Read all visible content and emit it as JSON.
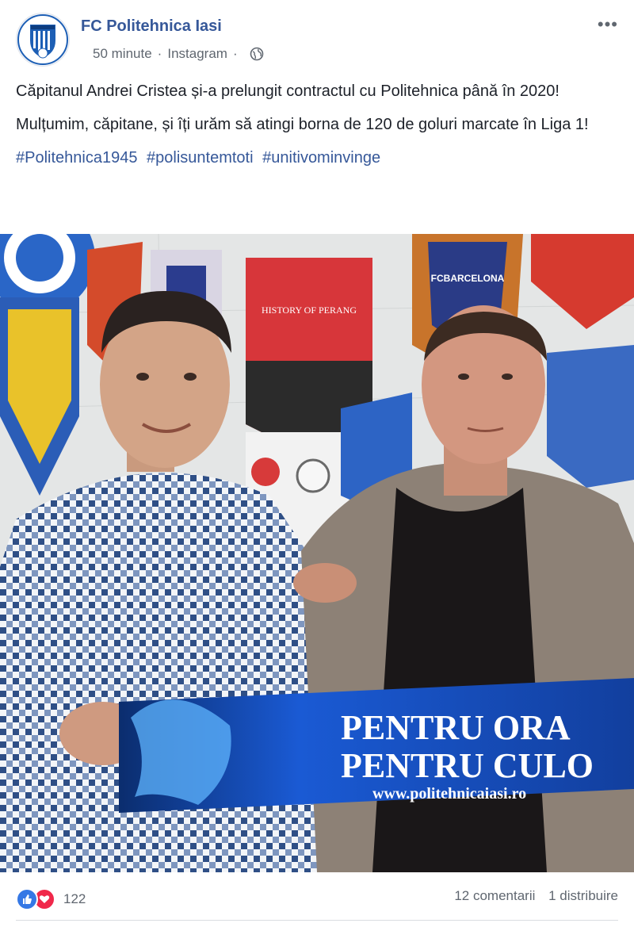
{
  "post": {
    "page_name": "FC Politehnica Iasi",
    "time": "50 minute",
    "separator": "·",
    "source": "Instagram",
    "paragraphs": [
      "Căpitanul Andrei Cristea și-a prelungit contractul cu Politehnica până în 2020!",
      "Mulțumim, căpitane, și îți urăm să atingi borna de 120 de goluri marcate în Liga 1!"
    ],
    "hashtags": [
      "#Politehnica1945",
      "#polisuntemtoti",
      "#unitivominvinge"
    ],
    "more_label": "•••"
  },
  "photo": {
    "scarf_line1": "PENTRU ORA",
    "scarf_line2": "PENTRU CULO",
    "scarf_url": "www.politehnicaiasi.ro",
    "pennant_barcelona": "FCBARCELONA",
    "pennant_history": "HISTORY OF PERANG"
  },
  "footer": {
    "reaction_count": "122",
    "comments": "12 comentarii",
    "shares": "1 distribuire"
  },
  "colors": {
    "link": "#365899",
    "like": "#3578e5",
    "love": "#f0284a",
    "meta": "#606770"
  }
}
